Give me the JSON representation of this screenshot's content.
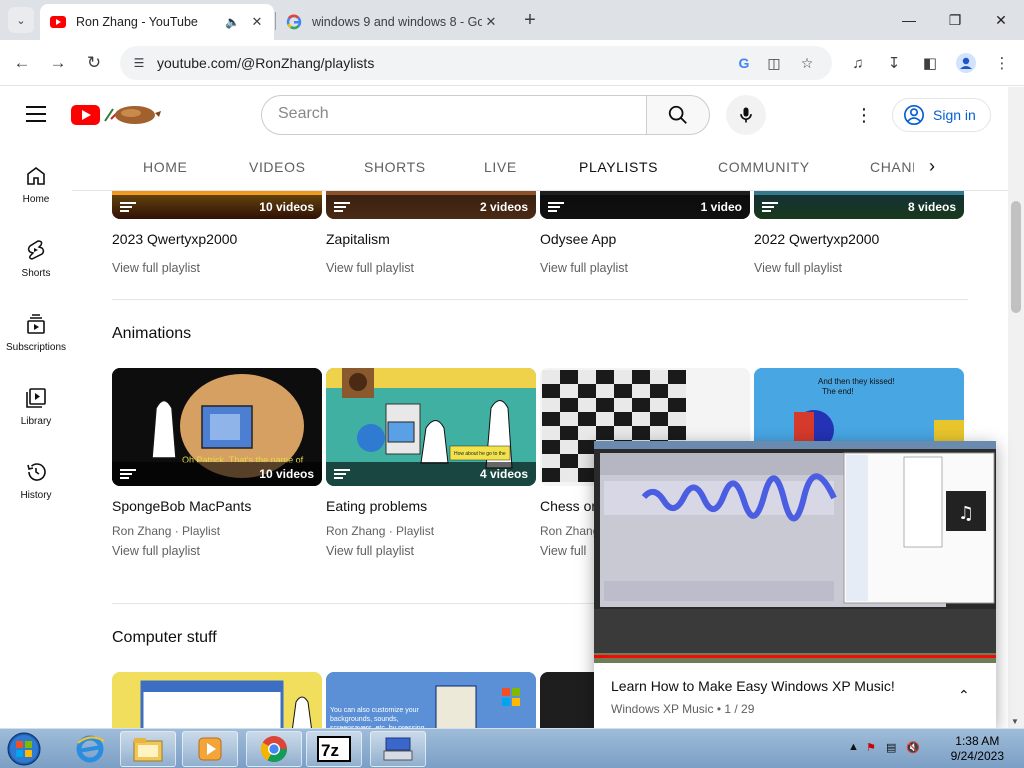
{
  "browser": {
    "tabs": [
      {
        "title": "Ron Zhang - YouTube",
        "active": true
      },
      {
        "title": "windows 9 and windows 8 - Go",
        "active": false
      }
    ],
    "url": "youtube.com/@RonZhang/playlists"
  },
  "header": {
    "search_placeholder": "Search",
    "signin_label": "Sign in"
  },
  "guide": [
    {
      "label": "Home",
      "icon": "home-icon"
    },
    {
      "label": "Shorts",
      "icon": "shorts-icon"
    },
    {
      "label": "Subscriptions",
      "icon": "subscriptions-icon"
    },
    {
      "label": "Library",
      "icon": "library-icon"
    },
    {
      "label": "History",
      "icon": "history-icon"
    }
  ],
  "channel_tabs": [
    "HOME",
    "VIDEOS",
    "SHORTS",
    "LIVE",
    "PLAYLISTS",
    "COMMUNITY",
    "CHANN"
  ],
  "top_row": [
    {
      "title": "2023 Qwertyxp2000",
      "count": "10 videos",
      "link": "View full playlist"
    },
    {
      "title": "Zapitalism",
      "count": "2 videos",
      "link": "View full playlist"
    },
    {
      "title": "Odysee App",
      "count": "1 video",
      "link": "View full playlist"
    },
    {
      "title": "2022 Qwertyxp2000",
      "count": "8 videos",
      "link": "View full playlist"
    }
  ],
  "animations": {
    "title": "Animations",
    "items": [
      {
        "title": "SpongeBob MacPants",
        "count": "10 videos",
        "sub": "Ron Zhang · Playlist",
        "link": "View full playlist"
      },
      {
        "title": "Eating problems",
        "count": "4 videos",
        "sub": "Ron Zhang · Playlist",
        "link": "View full playlist"
      },
      {
        "title": "Chess or",
        "count": "",
        "sub": "Ron Zhang",
        "link": "View full"
      },
      {
        "title": "",
        "count": "",
        "sub": "",
        "link": ""
      }
    ]
  },
  "computer": {
    "title": "Computer stuff"
  },
  "miniplayer": {
    "title": "Learn How to Make Easy Windows XP Music!",
    "channel": "Windows XP Music",
    "position": "1 / 29"
  },
  "taskbar": {
    "time": "1:38 AM",
    "date": "9/24/2023"
  }
}
